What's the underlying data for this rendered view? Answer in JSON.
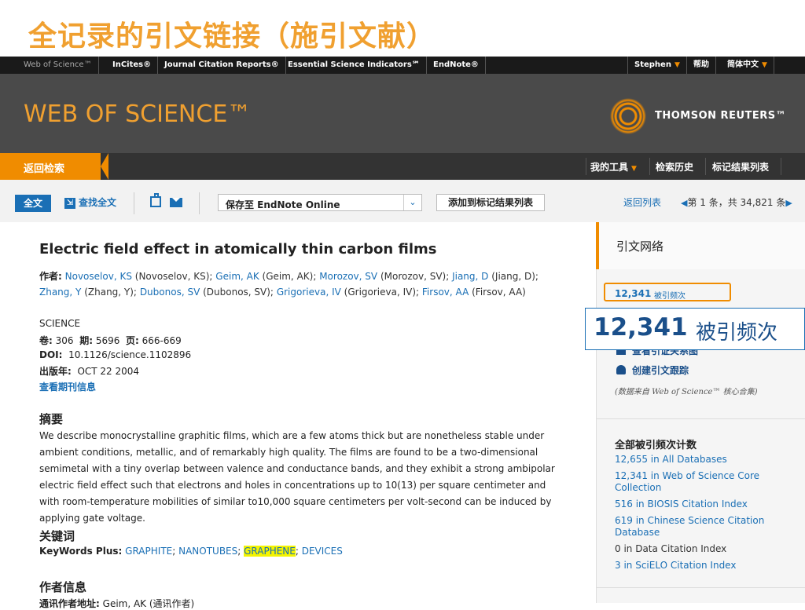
{
  "slide_title": "全记录的引文链接（施引文献）",
  "topnav": {
    "items": [
      "Web of Science™",
      "InCites®",
      "Journal Citation Reports®",
      "Essential Science Indicators℠",
      "EndNote®"
    ],
    "user": "Stephen",
    "help": "帮助",
    "language": "简体中文"
  },
  "banner": {
    "logo": "WEB OF SCIENCE™",
    "publisher": "THOMSON REUTERS™"
  },
  "subnav": {
    "back": "返回检索",
    "my_tools": "我的工具",
    "search_history": "检索历史",
    "marked_list": "标记结果列表"
  },
  "toolbar": {
    "full_text": "全文",
    "find_full_text": "查找全文",
    "save_to": "保存至 EndNote Online",
    "add_marked": "添加到标记结果列表",
    "return_list": "返回列表",
    "pager": "第 1 条，共 34,821 条"
  },
  "article": {
    "title": "Electric field effect in atomically thin carbon films",
    "by_label": "作者:",
    "authors": [
      {
        "short": "Novoselov, KS",
        "full": "(Novoselov, KS);"
      },
      {
        "short": "Geim, AK",
        "full": "(Geim, AK);"
      },
      {
        "short": "Morozov, SV",
        "full": "(Morozov, SV);"
      },
      {
        "short": "Jiang, D",
        "full": "(Jiang, D);"
      },
      {
        "short": "Zhang, Y",
        "full": "(Zhang, Y);"
      },
      {
        "short": "Dubonos, SV",
        "full": "(Dubonos, SV);"
      },
      {
        "short": "Grigorieva, IV",
        "full": "(Grigorieva, IV);"
      },
      {
        "short": "Firsov, AA",
        "full": "(Firsov, AA)"
      }
    ],
    "journal": "SCIENCE",
    "volume_label": "卷:",
    "volume": "306",
    "issue_label": "期:",
    "issue": "5696",
    "pages_label": "页:",
    "pages": "666-669",
    "doi_label": "DOI:",
    "doi": "10.1126/science.1102896",
    "pubdate_label": "出版年:",
    "pubdate": "OCT 22 2004",
    "journal_info": "查看期刊信息",
    "abstract_heading": "摘要",
    "abstract": "We describe monocrystalline graphitic films, which are a few atoms thick but are nonetheless stable under ambient conditions, metallic, and of remarkably high quality. The films are found to be a two-dimensional semimetal with a tiny overlap between valence and conductance bands, and they exhibit a strong ambipolar electric field effect such that electrons and holes in concentrations up to 10(13) per square centimeter and with room-temperature mobilities of similar to10,000 square centimeters per volt-second can be induced by applying gate voltage.",
    "keywords_heading": "关键词",
    "keywords_label": "KeyWords Plus:",
    "keywords": [
      "GRAPHITE",
      "NANOTUBES",
      "GRAPHENE",
      "DEVICES"
    ],
    "author_info_heading": "作者信息",
    "reprint_label": "通讯作者地址:",
    "reprint_value": "Geim, AK (通讯作者)"
  },
  "side": {
    "heading": "引文网络",
    "times_cited_num": "12,341",
    "times_cited_label": "被引频次",
    "zoom_num": "12,341",
    "zoom_label": "被引频次",
    "view_map": "查看引证关系图",
    "create_alert": "创建引文跟踪",
    "note": "(数据来自 Web of Science™ 核心合集)",
    "counts_heading": "全部被引频次计数",
    "counts": [
      "12,655 in All Databases",
      "12,341 in Web of Science Core Collection",
      "516 in BIOSIS Citation Index",
      "619 in Chinese Science Citation Database",
      "0 in Data Citation Index",
      "3 in SciELO Citation Index"
    ]
  },
  "colors": {
    "accent": "#f08c00",
    "link": "#1a6fb5",
    "banner": "#4a4a4a",
    "highlight": "#f4f400"
  }
}
